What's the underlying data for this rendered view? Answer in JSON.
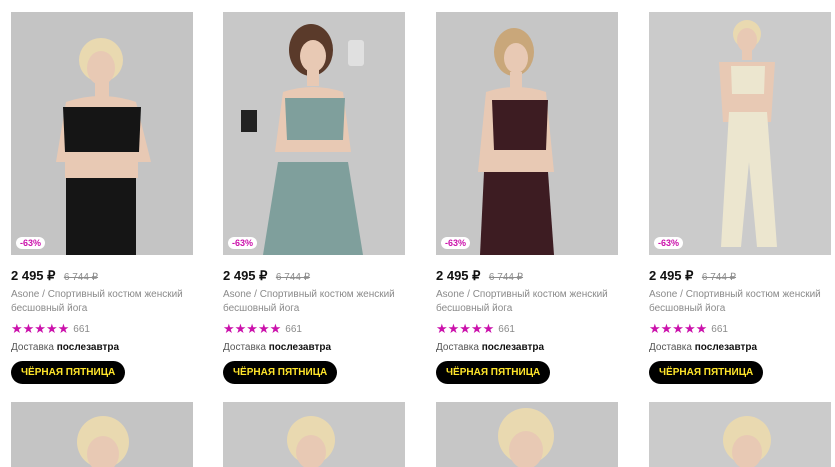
{
  "products": [
    {
      "discount": "-63%",
      "price": "2 495 ₽",
      "old_price": "6 744 ₽",
      "brand": "Asone",
      "title": "Asone / Спортивный костюм женский бесшовный йога",
      "rating_stars": 5,
      "reviews": "661",
      "delivery_label": "Доставка",
      "delivery_day": "послезавтра",
      "promo": "ЧЁРНАЯ ПЯТНИЦА",
      "outfit_color": "#151515",
      "bg_color": "#c4c4c4"
    },
    {
      "discount": "-63%",
      "price": "2 495 ₽",
      "old_price": "6 744 ₽",
      "brand": "Asone",
      "title": "Asone / Спортивный костюм женский бесшовный йога",
      "rating_stars": 5,
      "reviews": "661",
      "delivery_label": "Доставка",
      "delivery_day": "послезавтра",
      "promo": "ЧЁРНАЯ ПЯТНИЦА",
      "outfit_color": "#7f9f9c",
      "bg_color": "#c8c8c8"
    },
    {
      "discount": "-63%",
      "price": "2 495 ₽",
      "old_price": "6 744 ₽",
      "brand": "Asone",
      "title": "Asone / Спортивный костюм женский бесшовный йога",
      "rating_stars": 5,
      "reviews": "661",
      "delivery_label": "Доставка",
      "delivery_day": "послезавтра",
      "promo": "ЧЁРНАЯ ПЯТНИЦА",
      "outfit_color": "#3d1c22",
      "bg_color": "#c6c6c6"
    },
    {
      "discount": "-63%",
      "price": "2 495 ₽",
      "old_price": "6 744 ₽",
      "brand": "Asone",
      "title": "Asone / Спортивный костюм женский бесшовный йога",
      "rating_stars": 5,
      "reviews": "661",
      "delivery_label": "Доставка",
      "delivery_day": "послезавтра",
      "promo": "ЧЁРНАЯ ПЯТНИЦА",
      "outfit_color": "#ece6cf",
      "bg_color": "#cbcbcb"
    }
  ],
  "colors": {
    "accent": "#cb11ab",
    "promo_bg": "#000000",
    "promo_text": "#ffe52b"
  }
}
